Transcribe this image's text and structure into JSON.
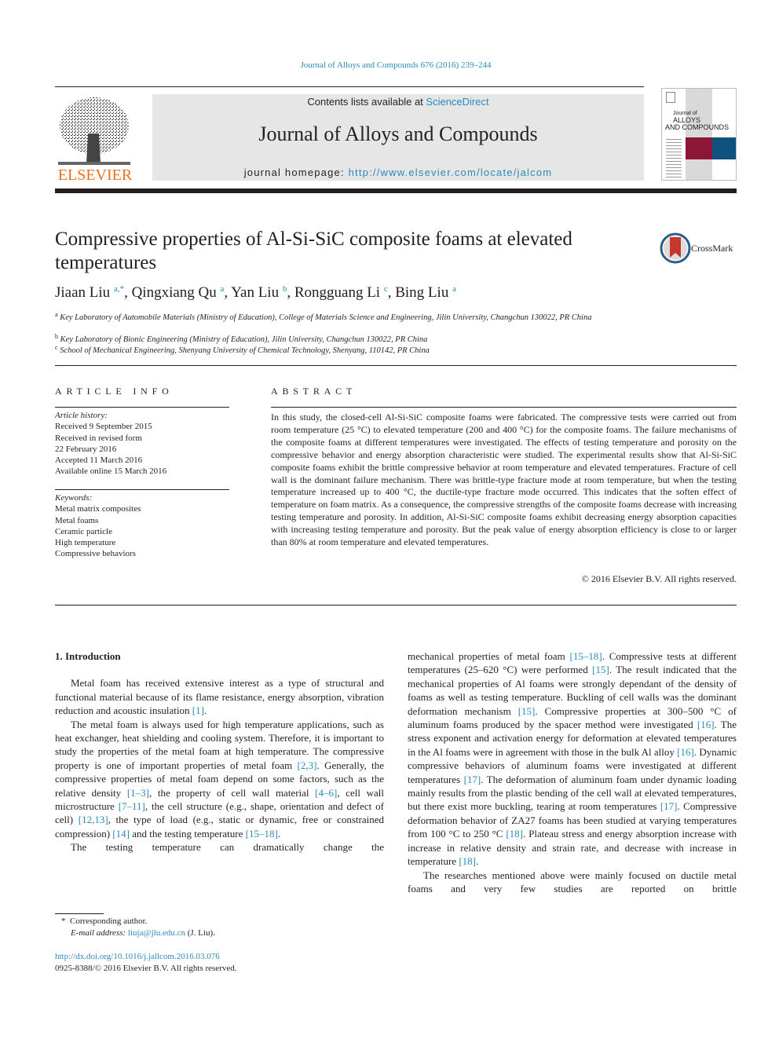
{
  "running_head": "Journal of Alloys and Compounds 676 (2016) 239–244",
  "header": {
    "publisher": "ELSEVIER",
    "contents_prefix": "Contents lists available at ",
    "contents_link": "ScienceDirect",
    "journal_name": "Journal of Alloys and Compounds",
    "homepage_prefix": "journal homepage: ",
    "homepage_link": "http://www.elsevier.com/locate/jalcom",
    "cover": {
      "line1": "Journal of",
      "line2": "ALLOYS",
      "line3": "AND COMPOUNDS",
      "colors": {
        "red": "#8c1538",
        "blue": "#0f517f"
      }
    }
  },
  "article": {
    "title": "Compressive properties of Al-Si-SiC composite foams at elevated temperatures",
    "crossmark_label": "CrossMark",
    "authors": [
      {
        "name": "Jiaan Liu",
        "sup": "a,*"
      },
      {
        "name": "Qingxiang Qu",
        "sup": "a"
      },
      {
        "name": "Yan Liu",
        "sup": "b"
      },
      {
        "name": "Rongguang Li",
        "sup": "c"
      },
      {
        "name": "Bing Liu",
        "sup": "a"
      }
    ],
    "affiliations": [
      {
        "key": "a",
        "text": "Key Laboratory of Automobile Materials (Ministry of Education), College of Materials Science and Engineering, Jilin University, Changchun 130022, PR China"
      },
      {
        "key": "b",
        "text": "Key Laboratory of Bionic Engineering (Ministry of Education), Jilin University, Changchun 130022, PR China"
      },
      {
        "key": "c",
        "text": "School of Mechanical Engineering, Shenyang University of Chemical Technology, Shenyang, 110142, PR China"
      }
    ]
  },
  "article_info": {
    "heading": "ARTICLE INFO",
    "history_label": "Article history:",
    "history": [
      "Received 9 September 2015",
      "Received in revised form",
      "22 February 2016",
      "Accepted 11 March 2016",
      "Available online 15 March 2016"
    ],
    "keywords_label": "Keywords:",
    "keywords": [
      "Metal matrix composites",
      "Metal foams",
      "Ceramic particle",
      "High temperature",
      "Compressive behaviors"
    ]
  },
  "abstract": {
    "heading": "ABSTRACT",
    "text": "In this study, the closed-cell Al-Si-SiC composite foams were fabricated. The compressive tests were carried out from room temperature (25 °C) to elevated temperature (200 and 400 °C) for the composite foams. The failure mechanisms of the composite foams at different temperatures were investigated. The effects of testing temperature and porosity on the compressive behavior and energy absorption characteristic were studied. The experimental results show that Al-Si-SiC composite foams exhibit the brittle compressive behavior at room temperature and elevated temperatures. Fracture of cell wall is the dominant failure mechanism. There was brittle-type fracture mode at room temperature, but when the testing temperature increased up to 400 °C, the ductile-type fracture mode occurred. This indicates that the soften effect of temperature on foam matrix. As a consequence, the compressive strengths of the composite foams decrease with increasing testing temperature and porosity. In addition, Al-Si-SiC composite foams exhibit decreasing energy absorption capacities with increasing testing temperature and porosity. But the peak value of energy absorption efficiency is close to or larger than 80% at room temperature and elevated temperatures.",
    "copyright": "© 2016 Elsevier B.V. All rights reserved."
  },
  "intro": {
    "heading": "1.  Introduction",
    "p1": {
      "t1": "Metal foam has received extensive interest as a type of structural and functional material because of its flame resistance, energy absorption, vibration reduction and acoustic insulation ",
      "r1": "[1]",
      "t2": "."
    },
    "p2": {
      "t1": "The metal foam is always used for high temperature applications, such as heat exchanger, heat shielding and cooling system. Therefore, it is important to study the properties of the metal foam at high temperature. The compressive property is one of important properties of metal foam ",
      "r1": "[2,3]",
      "t2": ". Generally, the compressive properties of metal foam depend on some factors, such as the relative density ",
      "r2": "[1–3]",
      "t3": ", the property of cell wall material ",
      "r3": "[4–6]",
      "t4": ", cell wall microstructure ",
      "r4": "[7–11]",
      "t5": ", the cell structure (e.g., shape, orientation and defect of cell) ",
      "r5": "[12,13]",
      "t6": ", the type of load (e.g., static or dynamic, free or constrained compression) ",
      "r6": "[14]",
      "t7": " and the testing temperature ",
      "r7": "[15–18]",
      "t8": "."
    },
    "p3_start": "The testing temperature can dramatically change the",
    "right": {
      "t1": "mechanical properties of metal foam ",
      "r1": "[15–18]",
      "t2": ". Compressive tests at different temperatures (25–620 °C) were performed ",
      "r2": "[15]",
      "t3": ". The result indicated that the mechanical properties of Al foams were strongly dependant of the density of foams as well as testing temperature. Buckling of cell walls was the dominant deformation mechanism ",
      "r3": "[15]",
      "t4": ". Compressive properties at 300–500 °C of aluminum foams produced by the spacer method were investigated ",
      "r4": "[16]",
      "t5": ". The stress exponent and activation energy for deformation at elevated temperatures in the Al foams were in agreement with those in the bulk Al alloy ",
      "r5": "[16]",
      "t6": ". Dynamic compressive behaviors of aluminum foams were investigated at different temperatures ",
      "r6": "[17]",
      "t7": ". The deformation of aluminum foam under dynamic loading mainly results from the plastic bending of the cell wall at elevated temperatures, but there exist more buckling, tearing at room temperatures ",
      "r7": "[17]",
      "t8": ". Compressive deformation behavior of ZA27 foams has been studied at varying temperatures from 100 °C to 250 °C ",
      "r8": "[18]",
      "t9": ". Plateau stress and energy absorption increase with increase in relative density and strain rate, and decrease with increase in temperature ",
      "r9": "[18]",
      "t10": "."
    },
    "right_p2": "The researches mentioned above were mainly focused on ductile metal foams and very few studies are reported on brittle"
  },
  "footnote": {
    "star": "*",
    "corresponding": "Corresponding author.",
    "email_label": "E-mail address: ",
    "email": "liuja@jlu.edu.cn",
    "email_suffix": " (J. Liu).",
    "doi": "http://dx.doi.org/10.1016/j.jallcom.2016.03.076",
    "issn": "0925-8388/© 2016 Elsevier B.V. All rights reserved."
  },
  "colors": {
    "link": "#2a8ab8",
    "elsevier_orange": "#e9711c",
    "banner_bg": "#e6e6e6"
  }
}
